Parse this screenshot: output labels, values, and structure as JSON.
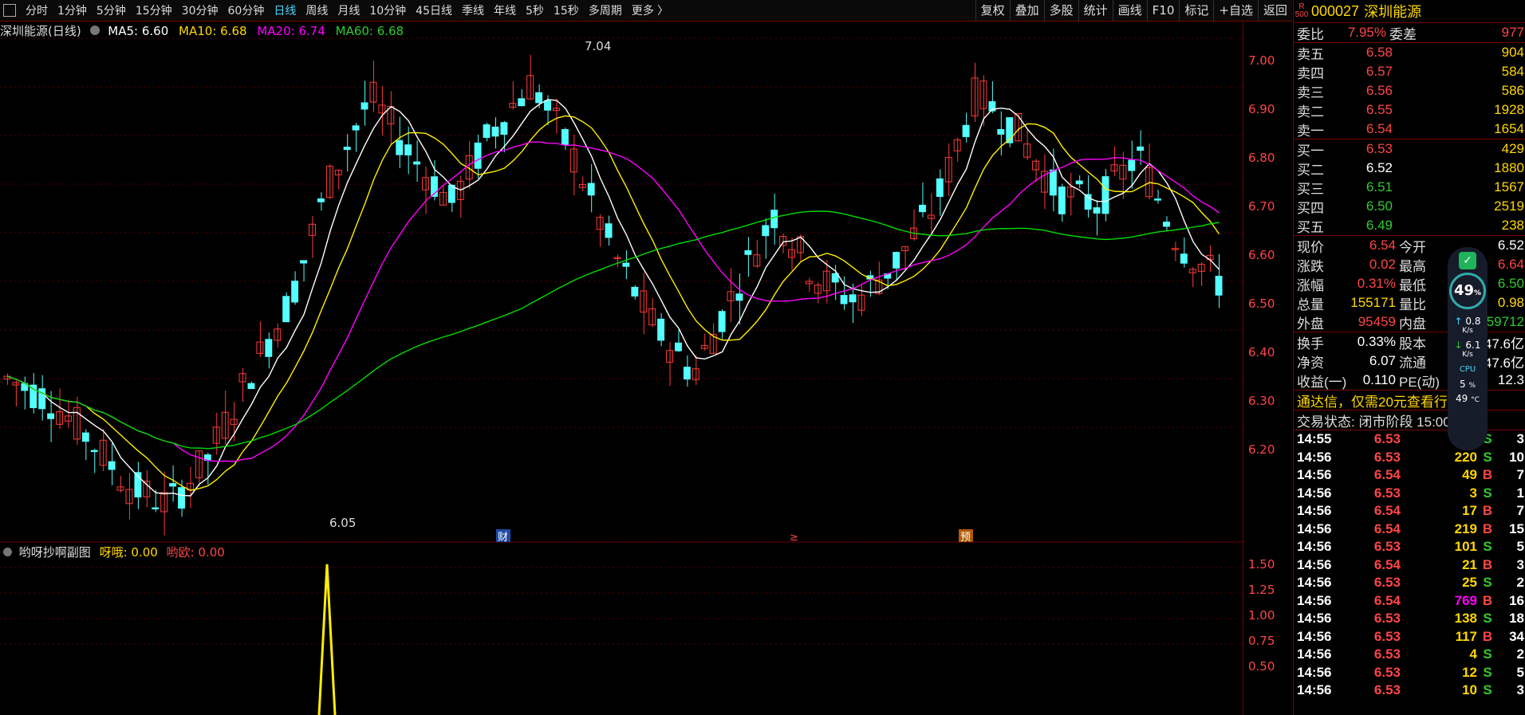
{
  "toolbar": {
    "tabs": [
      "分时",
      "1分钟",
      "5分钟",
      "15分钟",
      "30分钟",
      "60分钟",
      "日线",
      "周线",
      "月线",
      "10分钟",
      "45日线",
      "季线",
      "年线",
      "5秒",
      "15秒",
      "多周期",
      "更多 〉"
    ],
    "active_tab": "日线",
    "tools": [
      "复权",
      "叠加",
      "多股",
      "统计",
      "画线",
      "F10",
      "标记",
      "+自选",
      "返回"
    ]
  },
  "stock": {
    "code": "000027",
    "name": "深圳能源",
    "badge_top": "R",
    "badge_bottom": "500"
  },
  "ma_legend": {
    "title": "深圳能源(日线)",
    "ma5": "MA5: 6.60",
    "ma10": "MA10: 6.68",
    "ma20": "MA20: 6.74",
    "ma60": "MA60: 6.68"
  },
  "price_axis": [
    "7.00",
    "6.90",
    "6.80",
    "6.70",
    "6.60",
    "6.50",
    "6.40",
    "6.30",
    "6.20"
  ],
  "annotations": {
    "high": "7.04",
    "low": "6.05",
    "mark1": "财",
    "mark2": "≥",
    "mark3": "预"
  },
  "indicator": {
    "title": "哟呀抄啊副图",
    "v1": "呀哦: 0.00",
    "v2": "哟欧: 0.00",
    "axis": [
      "1.50",
      "1.25",
      "1.00",
      "0.75",
      "0.50"
    ]
  },
  "quote": {
    "weibi_label": "委比",
    "weibi": "7.95%",
    "weicha_label": "委差",
    "weicha": "977",
    "sells": [
      {
        "label": "卖五",
        "price": "6.58",
        "vol": "904"
      },
      {
        "label": "卖四",
        "price": "6.57",
        "vol": "584"
      },
      {
        "label": "卖三",
        "price": "6.56",
        "vol": "586"
      },
      {
        "label": "卖二",
        "price": "6.55",
        "vol": "1928"
      },
      {
        "label": "卖一",
        "price": "6.54",
        "vol": "1654"
      }
    ],
    "buys": [
      {
        "label": "买一",
        "price": "6.53",
        "vol": "429"
      },
      {
        "label": "买二",
        "price": "6.52",
        "vol": "1880"
      },
      {
        "label": "买三",
        "price": "6.51",
        "vol": "1567"
      },
      {
        "label": "买四",
        "price": "6.50",
        "vol": "2519"
      },
      {
        "label": "买五",
        "price": "6.49",
        "vol": "238"
      }
    ],
    "stats": [
      {
        "l1": "现价",
        "v1": "6.54",
        "l2": "今开",
        "v2": "6.52"
      },
      {
        "l1": "涨跌",
        "v1": "0.02",
        "l2": "最高",
        "v2": "6.64"
      },
      {
        "l1": "涨幅",
        "v1": "0.31%",
        "l2": "最低",
        "v2": "6.50"
      },
      {
        "l1": "总量",
        "v1": "155171",
        "l2": "量比",
        "v2": "0.98"
      },
      {
        "l1": "外盘",
        "v1": "95459",
        "l2": "内盘",
        "v2": "59712"
      }
    ],
    "stats2": [
      {
        "l1": "换手",
        "v1": "0.33%",
        "l2": "股本",
        "v2": "47.6亿"
      },
      {
        "l1": "净资",
        "v1": "6.07",
        "l2": "流通",
        "v2": "47.6亿"
      },
      {
        "l1": "收益(一)",
        "v1": "0.110",
        "l2": "PE(动)",
        "v2": "12.3"
      }
    ],
    "promo": "通达信，仅需20元查看行情",
    "status": "交易状态: 闭市阶段 15:00:00"
  },
  "ticks": [
    {
      "t": "14:55",
      "p": "6.53",
      "v": "19",
      "s": "S",
      "n": "3"
    },
    {
      "t": "14:56",
      "p": "6.53",
      "v": "220",
      "s": "S",
      "n": "10"
    },
    {
      "t": "14:56",
      "p": "6.54",
      "v": "49",
      "s": "B",
      "n": "7"
    },
    {
      "t": "14:56",
      "p": "6.53",
      "v": "3",
      "s": "S",
      "n": "1"
    },
    {
      "t": "14:56",
      "p": "6.54",
      "v": "17",
      "s": "B",
      "n": "7"
    },
    {
      "t": "14:56",
      "p": "6.54",
      "v": "219",
      "s": "B",
      "n": "15"
    },
    {
      "t": "14:56",
      "p": "6.53",
      "v": "101",
      "s": "S",
      "n": "5"
    },
    {
      "t": "14:56",
      "p": "6.54",
      "v": "21",
      "s": "B",
      "n": "3"
    },
    {
      "t": "14:56",
      "p": "6.53",
      "v": "25",
      "s": "S",
      "n": "2"
    },
    {
      "t": "14:56",
      "p": "6.54",
      "v": "769",
      "s": "B",
      "n": "16"
    },
    {
      "t": "14:56",
      "p": "6.53",
      "v": "138",
      "s": "S",
      "n": "18"
    },
    {
      "t": "14:56",
      "p": "6.53",
      "v": "117",
      "s": "B",
      "n": "34"
    },
    {
      "t": "14:56",
      "p": "6.53",
      "v": "4",
      "s": "S",
      "n": "2"
    },
    {
      "t": "14:56",
      "p": "6.53",
      "v": "12",
      "s": "S",
      "n": "5"
    },
    {
      "t": "14:56",
      "p": "6.53",
      "v": "10",
      "s": "S",
      "n": "3"
    }
  ],
  "widget": {
    "cpu_pct": "49",
    "up": "0.8",
    "down": "6.1",
    "unit": "K/s",
    "cpu_label": "CPU",
    "cpu_use": "5",
    "temp": "49"
  }
}
